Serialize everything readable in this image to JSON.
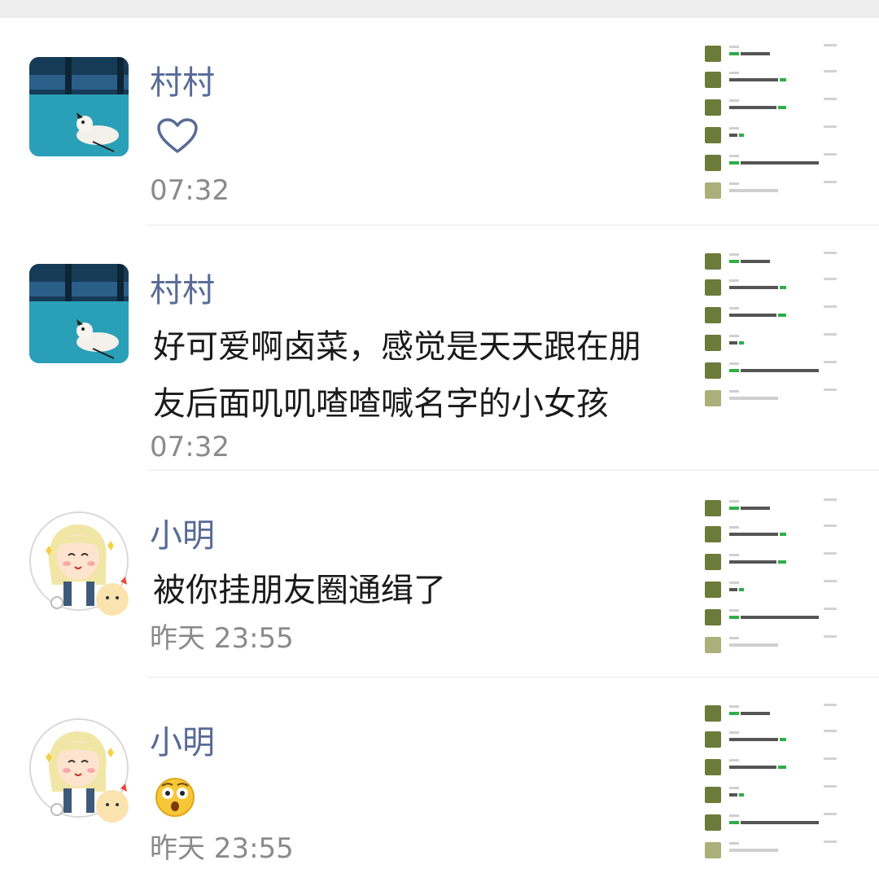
{
  "comments": [
    {
      "user": "村村",
      "content_type": "heart",
      "message": "",
      "time": "07:32",
      "avatar_icon": "dog-photo-avatar"
    },
    {
      "user": "村村",
      "content_type": "text",
      "message_line1": "好可爱啊卤菜，感觉是天天跟在朋",
      "message_line2": "友后面叽叽喳喳喊名字的小女孩",
      "time": "07:32",
      "avatar_icon": "dog-photo-avatar"
    },
    {
      "user": "小明",
      "content_type": "text",
      "message": "被你挂朋友圈通缉了",
      "time": "昨天 23:55",
      "avatar_icon": "cartoon-girl-avatar"
    },
    {
      "user": "小明",
      "content_type": "emoji",
      "message": "",
      "emoji_icon": "shocked-face-emoji",
      "time": "昨天 23:55",
      "avatar_icon": "cartoon-girl-avatar"
    }
  ],
  "colors": {
    "username": "#576b95",
    "text": "#1a1a1a",
    "time": "#8a8a8a",
    "accent_green": "#2fae4a",
    "top_bar": "#ededed"
  }
}
